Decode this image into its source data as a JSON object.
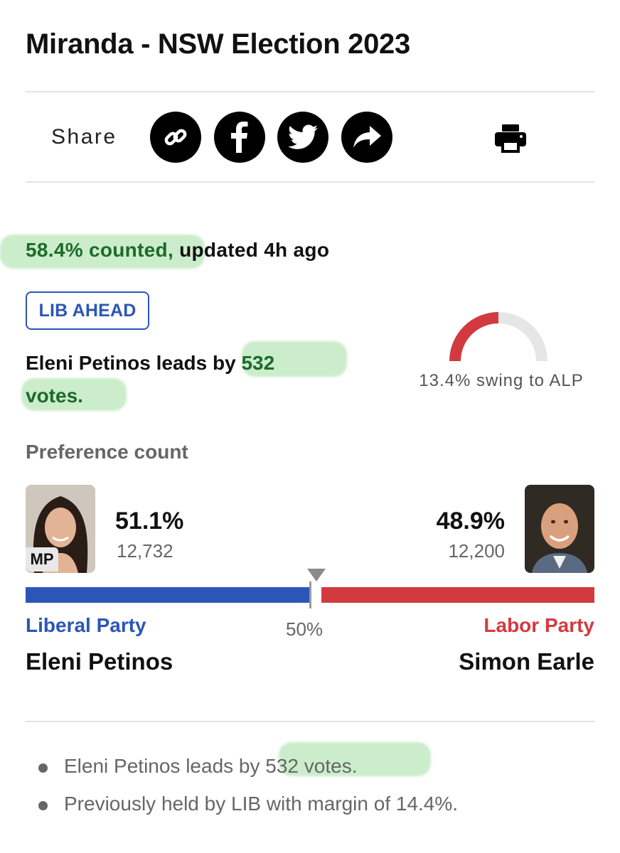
{
  "header": {
    "title": "Miranda - NSW Election 2023"
  },
  "share": {
    "label": "Share",
    "buttons": [
      "link-icon",
      "facebook-icon",
      "twitter-icon",
      "share-arrow-icon"
    ],
    "print_icon": "printer-icon"
  },
  "status": {
    "counted": "58.4% counted,",
    "updated": " updated 4h ago"
  },
  "badge": {
    "label": "LIB AHEAD"
  },
  "leads": {
    "prefix": "Eleni Petinos leads by ",
    "amount": "532",
    "suffix": "votes."
  },
  "swing": {
    "text": "13.4% swing to ALP",
    "value": 13.4
  },
  "preference": {
    "label": "Preference count",
    "midpoint_label": "50%",
    "left": {
      "tag": "MP",
      "percent": "51.1%",
      "votes": "12,732",
      "share": 51.1,
      "party": "Liberal Party",
      "name": "Eleni Petinos",
      "color": "#2b56b8"
    },
    "right": {
      "percent": "48.9%",
      "votes": "12,200",
      "share": 48.9,
      "party": "Labor Party",
      "name": "Simon Earle",
      "color": "#d33a3f"
    }
  },
  "notes": {
    "line1_prefix": "Eleni Petinos leads by ",
    "line1_value": "532 votes.",
    "line2": "Previously held by LIB with margin of 14.4%."
  }
}
